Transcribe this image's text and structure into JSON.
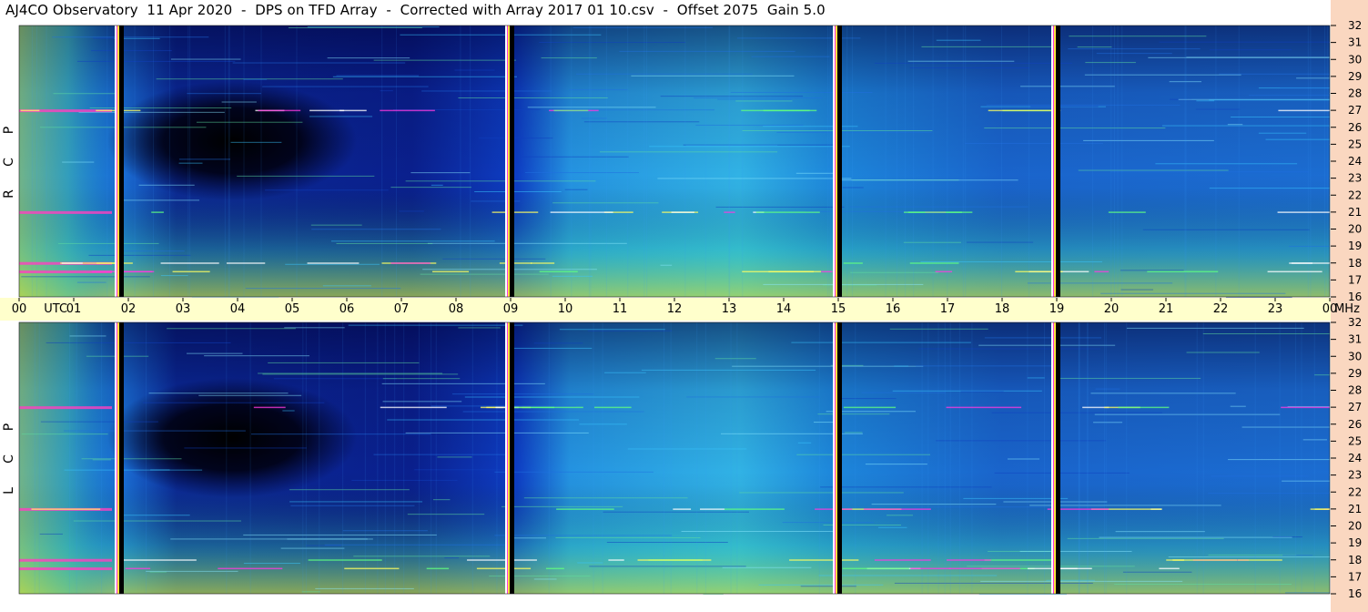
{
  "title": "AJ4CO Observatory  11 Apr 2020  -  DPS on TFD Array  -  Corrected with Array 2017 01 10.csv  -  Offset 2075  Gain 5.0",
  "chart_data": [
    {
      "type": "heatmap",
      "panel": "top",
      "ylabel_letters": [
        "P",
        "C",
        "R"
      ],
      "ylim": [
        16,
        32
      ],
      "yticks": [
        16,
        17,
        18,
        19,
        20,
        21,
        22,
        23,
        24,
        25,
        26,
        27,
        28,
        29,
        30,
        31,
        32
      ],
      "xlim": [
        0,
        24
      ],
      "colormap": "black-blue-cyan-green-yellow-magenta",
      "dark_region_hours": [
        2.3,
        5.5
      ],
      "cal_gaps_hours": [
        1.85,
        9.0,
        15.0,
        19.0
      ],
      "rfi_bands_mhz": [
        27.0,
        17.5,
        18.0,
        21.0
      ]
    },
    {
      "type": "heatmap",
      "panel": "bottom",
      "ylabel_letters": [
        "P",
        "C",
        "L"
      ],
      "ylim": [
        16,
        32
      ],
      "yticks": [
        16,
        17,
        18,
        19,
        20,
        21,
        22,
        23,
        24,
        25,
        26,
        27,
        28,
        29,
        30,
        31,
        32
      ],
      "xlim": [
        0,
        24
      ],
      "colormap": "black-blue-cyan-green-yellow-magenta",
      "dark_region_hours": [
        2.3,
        5.5
      ],
      "cal_gaps_hours": [
        1.85,
        9.0,
        15.0,
        19.0
      ],
      "rfi_bands_mhz": [
        27.0,
        17.5,
        18.0,
        21.0
      ]
    }
  ],
  "time_axis": {
    "labels": [
      "00",
      "UTC",
      "01",
      "02",
      "03",
      "04",
      "05",
      "06",
      "07",
      "08",
      "09",
      "10",
      "11",
      "12",
      "13",
      "14",
      "15",
      "16",
      "17",
      "18",
      "19",
      "20",
      "21",
      "22",
      "23",
      "00",
      "MHz"
    ],
    "hours": [
      0,
      1,
      2,
      3,
      4,
      5,
      6,
      7,
      8,
      9,
      10,
      11,
      12,
      13,
      14,
      15,
      16,
      17,
      18,
      19,
      20,
      21,
      22,
      23,
      24
    ]
  },
  "colors": {
    "axis_band": "#ffffcc",
    "freq_strip": "#fad7c0",
    "deep_blue": "#0033cc",
    "black": "#000000"
  }
}
